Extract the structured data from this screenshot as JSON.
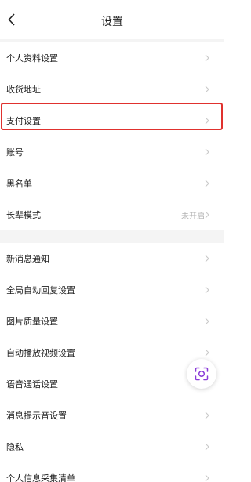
{
  "header": {
    "title": "设置"
  },
  "group1": [
    {
      "label": "个人资料设置",
      "value": ""
    },
    {
      "label": "收货地址",
      "value": ""
    },
    {
      "label": "支付设置",
      "value": ""
    },
    {
      "label": "账号",
      "value": ""
    },
    {
      "label": "黑名单",
      "value": ""
    },
    {
      "label": "长辈模式",
      "value": "未开启"
    }
  ],
  "group2": [
    {
      "label": "新消息通知",
      "value": ""
    },
    {
      "label": "全局自动回复设置",
      "value": ""
    },
    {
      "label": "图片质量设置",
      "value": ""
    },
    {
      "label": "自动播放视频设置",
      "value": ""
    },
    {
      "label": "语音通话设置",
      "value": ""
    },
    {
      "label": "消息提示音设置",
      "value": ""
    },
    {
      "label": "隐私",
      "value": ""
    },
    {
      "label": "个人信息采集清单",
      "value": ""
    }
  ],
  "colors": {
    "highlight": "#e0312e",
    "chevron": "#c8c8c8",
    "separator": "#f4f4f4"
  },
  "icons": {
    "back": "chevron-left-icon",
    "row_arrow": "chevron-right-icon",
    "floating": "scan-icon"
  }
}
